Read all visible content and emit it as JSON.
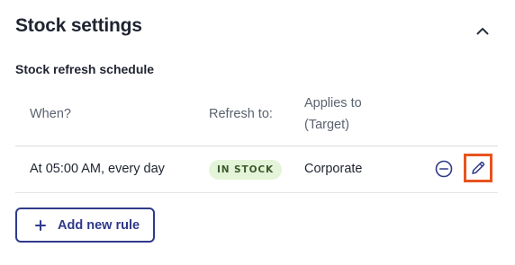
{
  "section": {
    "title": "Stock settings",
    "collapse_icon": "chevron-up-icon"
  },
  "schedule": {
    "title": "Stock refresh schedule",
    "columns": {
      "when": "When?",
      "refresh": "Refresh to:",
      "applies_line1": "Applies to",
      "applies_line2": "(Target)"
    },
    "rows": [
      {
        "when": "At 05:00 AM, every day",
        "refresh_badge": "IN STOCK",
        "target": "Corporate",
        "remove_icon": "minus-circle-icon",
        "edit_icon": "pencil-icon"
      }
    ]
  },
  "actions": {
    "add_rule_label": "Add new rule",
    "add_icon": "plus-icon"
  },
  "colors": {
    "accent": "#2f3a8a",
    "badge_bg": "#e4f4d9",
    "highlight": "#e8531e"
  }
}
